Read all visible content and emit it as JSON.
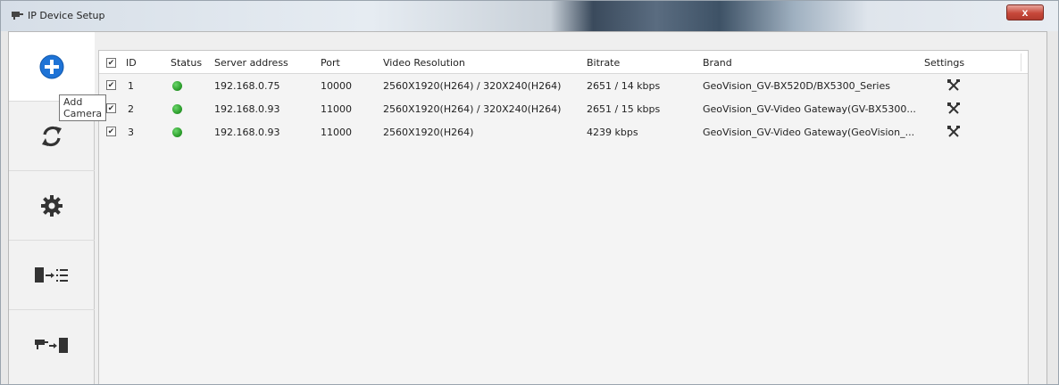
{
  "window": {
    "title": "IP Device Setup",
    "close_label": "x"
  },
  "sidebar": {
    "items": [
      {
        "icon": "add-circle-icon"
      },
      {
        "icon": "refresh-icon"
      },
      {
        "icon": "gear-icon"
      },
      {
        "icon": "device-to-list-icon"
      },
      {
        "icon": "camera-to-device-icon"
      }
    ],
    "tooltip": "Add Camera"
  },
  "table": {
    "headers": {
      "id": "ID",
      "status": "Status",
      "server": "Server address",
      "port": "Port",
      "resolution": "Video Resolution",
      "bitrate": "Bitrate",
      "brand": "Brand",
      "settings": "Settings"
    },
    "rows": [
      {
        "checked": true,
        "id": "1",
        "status": "online",
        "server": "192.168.0.75",
        "port": "10000",
        "resolution": "2560X1920(H264) / 320X240(H264)",
        "bitrate": "2651 / 14 kbps",
        "brand": "GeoVision_GV-BX520D/BX5300_Series"
      },
      {
        "checked": true,
        "id": "2",
        "status": "online",
        "server": "192.168.0.93",
        "port": "11000",
        "resolution": "2560X1920(H264) / 320X240(H264)",
        "bitrate": "2651 / 15 kbps",
        "brand": "GeoVision_GV-Video Gateway(GV-BX5300..."
      },
      {
        "checked": true,
        "id": "3",
        "status": "online",
        "server": "192.168.0.93",
        "port": "11000",
        "resolution": "2560X1920(H264)",
        "bitrate": "4239 kbps",
        "brand": "GeoVision_GV-Video Gateway(GeoVision_..."
      }
    ]
  },
  "colors": {
    "status_online": "#2ea02e",
    "accent": "#1e73d6"
  }
}
